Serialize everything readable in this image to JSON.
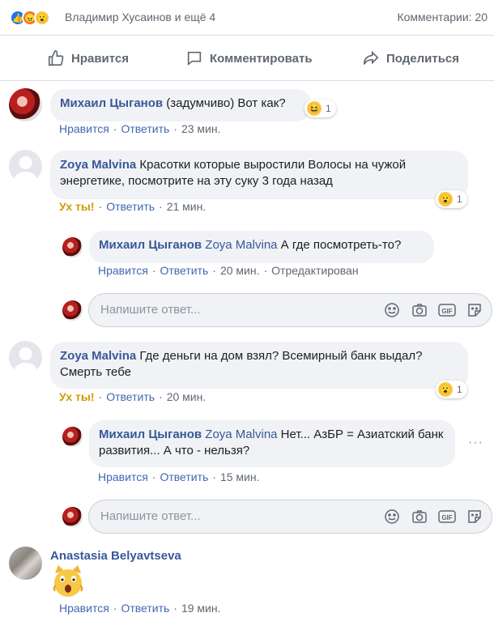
{
  "header": {
    "reactions": [
      "like-icon",
      "angry-icon",
      "wow-icon"
    ],
    "names": "Владимир Хусаинов и ещё 4",
    "comments_count": "Комментарии: 20"
  },
  "actions": {
    "like": "Нравится",
    "comment": "Комментировать",
    "share": "Поделиться"
  },
  "comments": [
    {
      "author": "Михаил Цыганов",
      "text": "(задумчиво) Вот как?",
      "like": "Нравится",
      "reply": "Ответить",
      "time": "23 мин.",
      "reaction_count": "1"
    },
    {
      "author": "Zoya Malvina",
      "text": "Красотки которые выростили Волосы на чужой энергетике, посмотрите на эту суку 3 года назад",
      "reaction_label": "Ух ты!",
      "reply": "Ответить",
      "time": "21 мин.",
      "reaction_count": "1",
      "replies": [
        {
          "author": "Михаил Цыганов",
          "mention": "Zoya Malvina",
          "text": "А где посмотреть-то?",
          "like": "Нравится",
          "reply": "Ответить",
          "time": "20 мин.",
          "edited": "Отредактирован"
        }
      ]
    },
    {
      "author": "Zoya Malvina",
      "text": "Где деньги на дом взял? Всемирный банк выдал? Смерть тебе",
      "reaction_label": "Ух ты!",
      "reply": "Ответить",
      "time": "20 мин.",
      "reaction_count": "1",
      "replies": [
        {
          "author": "Михаил Цыганов",
          "mention": "Zoya Malvina",
          "text": "Нет... АзБР = Азиатский банк развития... А что - нельзя?",
          "like": "Нравится",
          "reply": "Ответить",
          "time": "15 мин."
        }
      ]
    },
    {
      "author": "Anastasia Belyavtseva",
      "sticker": "shocked-cat-sticker",
      "like": "Нравится",
      "reply": "Ответить",
      "time": "19 мин."
    }
  ],
  "reply_box": {
    "placeholder": "Напишите ответ...",
    "tools": [
      "emoji-icon",
      "camera-icon",
      "gif-icon",
      "sticker-icon"
    ]
  },
  "more_glyph": "···",
  "separator": "·",
  "colors": {
    "link": "#385898",
    "wow_label": "#d09a00",
    "bubble": "#f0f2f5"
  }
}
